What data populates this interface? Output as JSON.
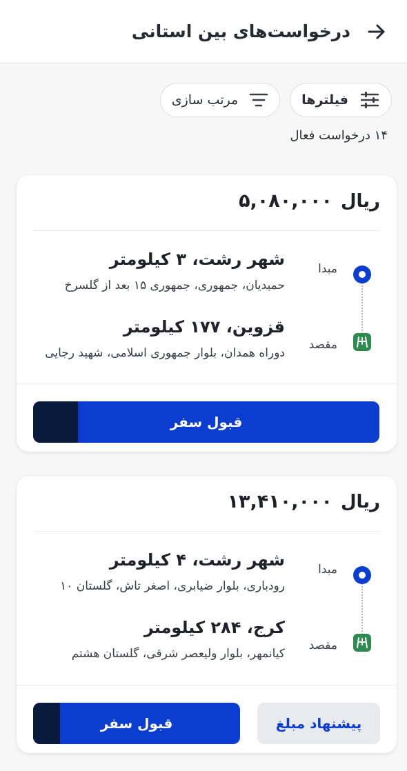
{
  "header": {
    "title": "درخواست‌های بین استانی",
    "back_icon": "arrow-right-icon"
  },
  "controls": {
    "filters_label": "فیلترها",
    "sort_label": "مرتب سازی"
  },
  "summary": {
    "active_count_text": "۱۴ درخواست فعال"
  },
  "requests": [
    {
      "price": "۵,۰۸۰,۰۰۰",
      "currency": "ریال",
      "origin": {
        "label": "مبدا",
        "title": "شهر رشت، ۳ کیلومتر",
        "address": "حمیدیان، جمهوری، جمهوری ۱۵ بعد از گلسرخ"
      },
      "destination": {
        "label": "مقصد",
        "title": "قزوین، ۱۷۷ کیلومتر",
        "address": "دوراه همدان، بلوار جمهوری اسلامی، شهید رجایی"
      },
      "accept_label": "قبول سفر"
    },
    {
      "price": "۱۳,۴۱۰,۰۰۰",
      "currency": "ریال",
      "origin": {
        "label": "مبدا",
        "title": "شهر رشت، ۴ کیلومتر",
        "address": "رودباری، بلوار ضیابری، اصغر تاش، گلستان ۱۰"
      },
      "destination": {
        "label": "مقصد",
        "title": "کرج، ۲۸۴ کیلومتر",
        "address": "کیانمهر، بلوار ولیعصر شرقی، گلستان هشتم"
      },
      "offer_label": "پیشنهاد مبلغ",
      "accept_label": "قبول سفر"
    }
  ],
  "colors": {
    "primary": "#0b3ed0",
    "dark_strip": "#0a1a3d",
    "destination_badge": "#2f8a50"
  }
}
